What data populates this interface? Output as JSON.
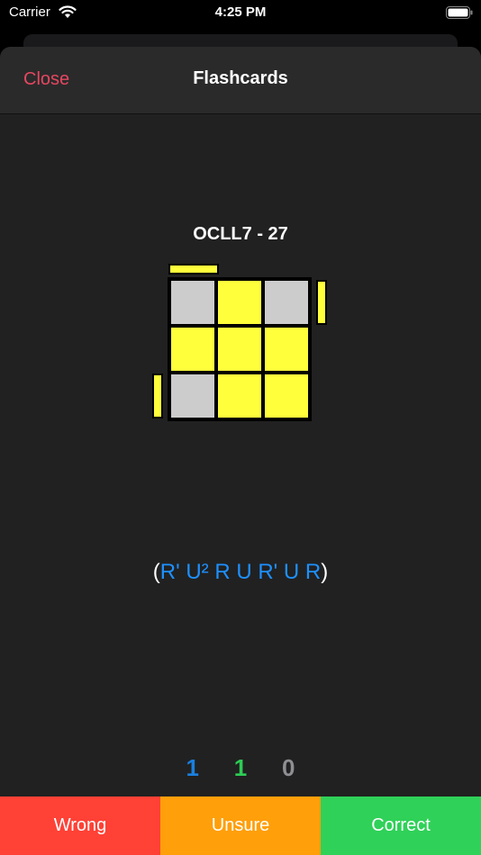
{
  "status_bar": {
    "carrier": "Carrier",
    "time": "4:25 PM"
  },
  "nav": {
    "close_label": "Close",
    "title": "Flashcards"
  },
  "card": {
    "case_title": "OCLL7 - 27",
    "algorithm": {
      "open_paren": "(",
      "moves": "R' U² R U R' U R",
      "close_paren": ")"
    }
  },
  "counts": {
    "wrong": "1",
    "correct": "1",
    "unsure": "0"
  },
  "count_colors": {
    "wrong": "#1a7fe0",
    "correct": "#2ecc55",
    "unsure": "#8e8e93"
  },
  "buttons": {
    "wrong": {
      "label": "Wrong",
      "color": "#ff4136"
    },
    "unsure": {
      "label": "Unsure",
      "color": "#ff9f0a"
    },
    "correct": {
      "label": "Correct",
      "color": "#2fd158"
    }
  },
  "cube": {
    "colors": {
      "yellow": "#ffff3c",
      "gray": "#cccccc"
    },
    "top_face": [
      [
        "gray",
        "yellow",
        "gray"
      ],
      [
        "yellow",
        "yellow",
        "yellow"
      ],
      [
        "gray",
        "yellow",
        "yellow"
      ]
    ],
    "side_stickers": [
      "back-left",
      "right-top",
      "left-bottom"
    ]
  }
}
